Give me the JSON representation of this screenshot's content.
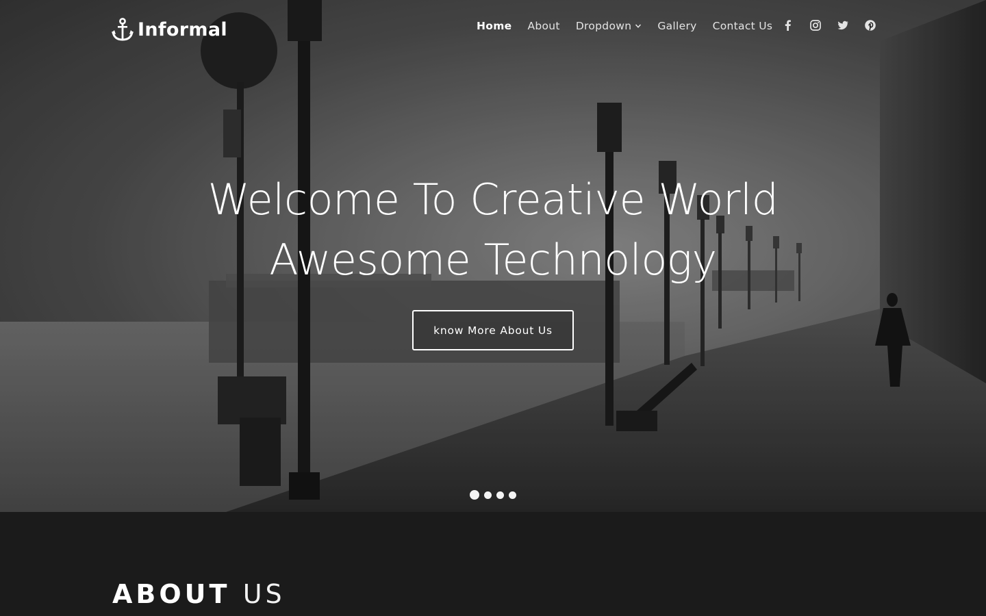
{
  "brand": {
    "name": "Informal",
    "icon": "anchor-icon"
  },
  "nav": {
    "items": [
      {
        "label": "Home",
        "active": true
      },
      {
        "label": "About"
      },
      {
        "label": "Dropdown",
        "has_dropdown": true
      },
      {
        "label": "Gallery"
      },
      {
        "label": "Contact Us"
      }
    ],
    "social": [
      "facebook-icon",
      "instagram-icon",
      "twitter-icon",
      "pinterest-icon"
    ]
  },
  "hero": {
    "headline_line1": "Welcome To Creative World",
    "headline_line2": "Awesome Technology",
    "cta_label": "know More About Us",
    "slides": 4,
    "active_slide": 1
  },
  "about": {
    "title_bold": "ABOUT",
    "title_light": "US"
  },
  "colors": {
    "page_bg": "#1b1b1b",
    "text": "#ffffff"
  }
}
